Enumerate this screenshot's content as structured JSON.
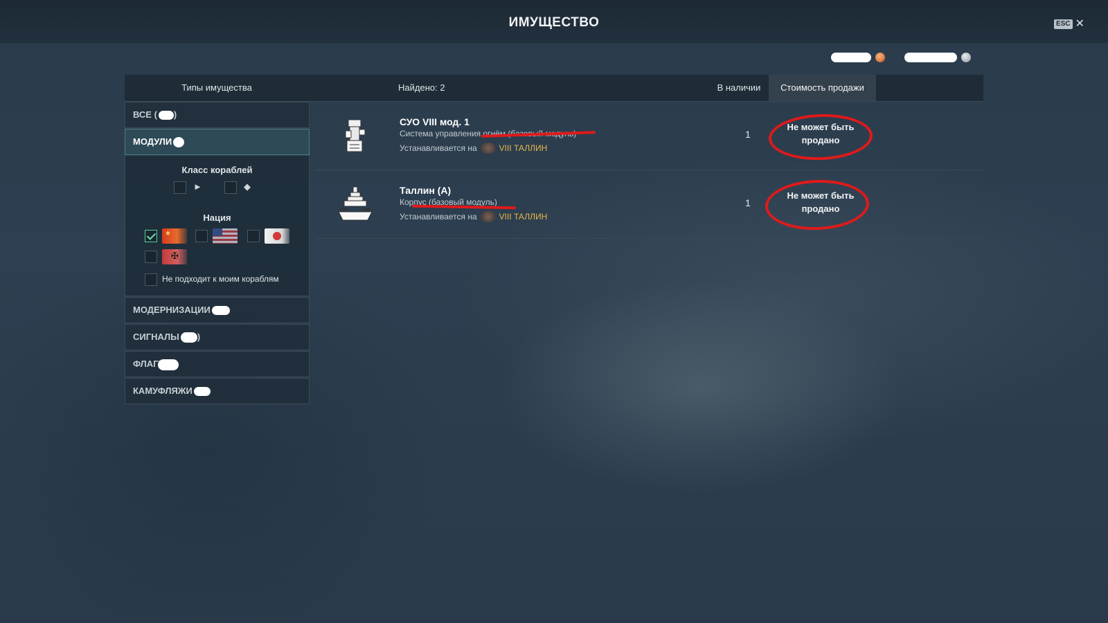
{
  "window": {
    "title": "ИМУЩЕСТВО",
    "esc_label": "ESC",
    "close_glyph": "✕"
  },
  "currency": {
    "doubloons_icon": "doubloon-coin-icon",
    "credits_icon": "credit-coin-icon"
  },
  "table_header": {
    "types_label": "Типы имущества",
    "found_label": "Найдено: 2",
    "stock_label": "В наличии",
    "price_label": "Стоимость продажи"
  },
  "sidebar": {
    "categories": [
      {
        "label": "ВСЕ (",
        "suffix": ")",
        "active": false
      },
      {
        "label": "МОДУЛИ",
        "active": true
      },
      {
        "label": "МОДЕРНИЗАЦИИ",
        "active": false
      },
      {
        "label": "СИГНАЛЫ",
        "suffix": ")",
        "active": false
      },
      {
        "label": "ФЛАГИ",
        "active": false
      },
      {
        "label": "КАМУФЛЯЖИ",
        "active": false
      }
    ],
    "filters": {
      "ship_class_title": "Класс кораблей",
      "ship_classes": [
        "destroyer-class-icon",
        "cruiser-class-icon"
      ],
      "nation_title": "Нация",
      "nations": [
        {
          "name": "ussr-flag-icon",
          "checked": true
        },
        {
          "name": "usa-flag-icon",
          "checked": false
        },
        {
          "name": "japan-flag-icon",
          "checked": false
        },
        {
          "name": "germany-flag-icon",
          "checked": false
        }
      ],
      "mismatch_label": "Не подходит к моим кораблям",
      "mismatch_checked": false
    }
  },
  "items": [
    {
      "name": "СУО VIII мод. 1",
      "description": "Система управления огнём (базовый модуль)",
      "installed_label": "Устанавливается на",
      "ship": "VIII ТАЛЛИН",
      "quantity": "1",
      "price_line1": "Не может быть",
      "price_line2": "продано",
      "icon": "fire-control-module-icon"
    },
    {
      "name": "Таллин (А)",
      "description": "Корпус (базовый модуль)",
      "installed_label": "Устанавливается на",
      "ship": "VIII ТАЛЛИН",
      "quantity": "1",
      "price_line1": "Не может быть",
      "price_line2": "продано",
      "icon": "hull-module-icon"
    }
  ],
  "colors": {
    "annotation": "#e01a1a",
    "ship_link": "#e6b84a",
    "checkbox_check": "#6be0a8"
  }
}
